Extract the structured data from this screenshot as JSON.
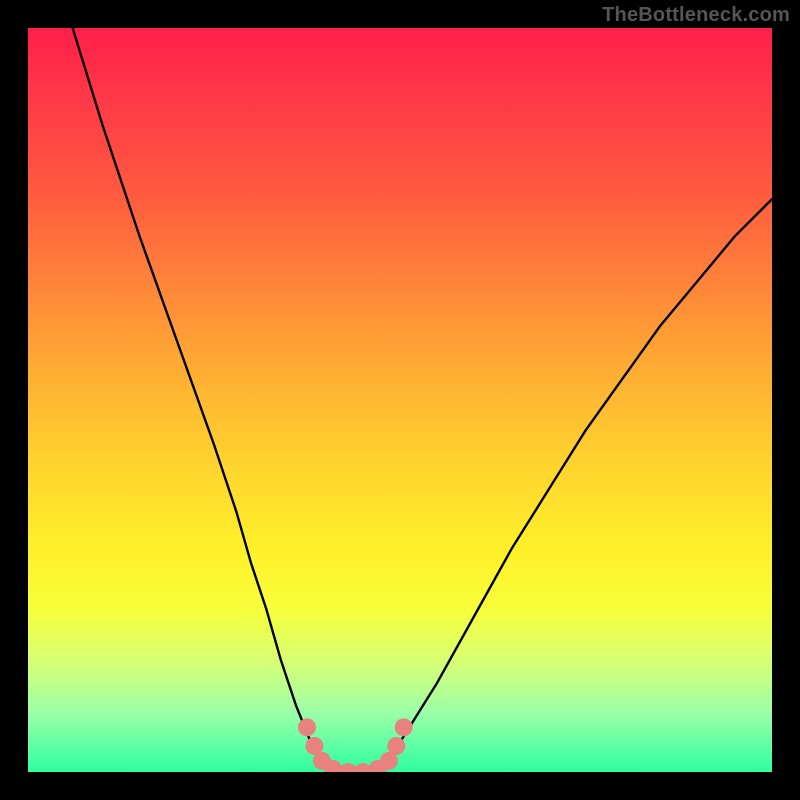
{
  "watermark": {
    "text": "TheBottleneck.com"
  },
  "colors": {
    "background": "#000000",
    "curve": "#000000",
    "marker": "#e8827e",
    "gradient_top": "#ff1f4a",
    "gradient_bottom": "#2effa0"
  },
  "chart_data": {
    "type": "line",
    "title": "",
    "xlabel": "",
    "ylabel": "",
    "xlim": [
      0,
      100
    ],
    "ylim": [
      0,
      100
    ],
    "series": [
      {
        "name": "bottleneck-curve",
        "x": [
          6,
          10,
          15,
          20,
          25,
          28,
          30,
          32,
          34,
          36,
          38,
          40,
          42,
          44,
          46,
          48,
          50,
          55,
          60,
          65,
          70,
          75,
          80,
          85,
          90,
          95,
          100
        ],
        "y": [
          100,
          87,
          72,
          58,
          44,
          35,
          28,
          22,
          15,
          9,
          4,
          1,
          0,
          0,
          0,
          1,
          4,
          12,
          21,
          30,
          38,
          46,
          53,
          60,
          66,
          72,
          77
        ]
      }
    ],
    "markers": {
      "name": "highlight-dots",
      "x": [
        37.5,
        38.5,
        39.5,
        41,
        43,
        45,
        47,
        48.5,
        49.5,
        50.5
      ],
      "y": [
        6,
        3.5,
        1.5,
        0.4,
        0,
        0,
        0.4,
        1.5,
        3.5,
        6
      ]
    }
  }
}
